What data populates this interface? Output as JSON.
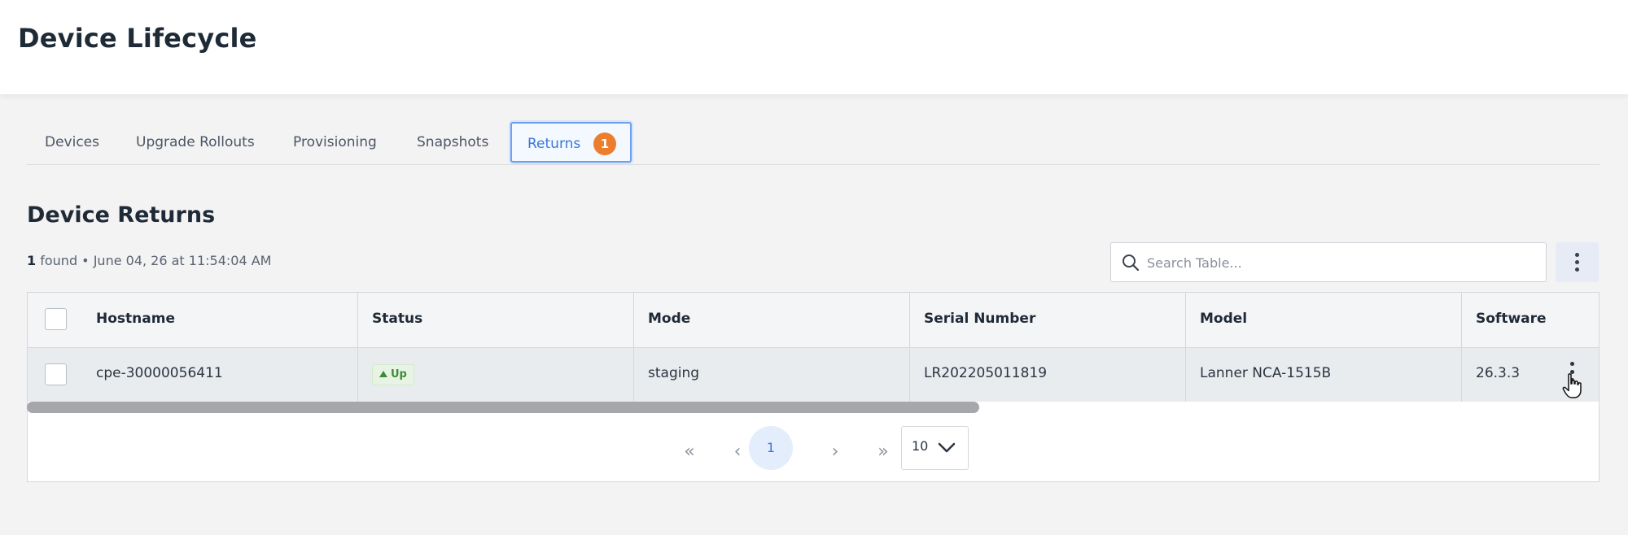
{
  "page": {
    "title": "Device Lifecycle"
  },
  "tabs": [
    {
      "label": "Devices"
    },
    {
      "label": "Upgrade Rollouts"
    },
    {
      "label": "Provisioning"
    },
    {
      "label": "Snapshots"
    },
    {
      "label": "Returns",
      "badge": "1",
      "active": true
    }
  ],
  "section": {
    "title": "Device Returns",
    "found_count": "1",
    "found_text": "found • June 04, 26 at 11:54:04 AM"
  },
  "search": {
    "placeholder": "Search Table..."
  },
  "table": {
    "columns": [
      "Hostname",
      "Status",
      "Mode",
      "Serial Number",
      "Model",
      "Software"
    ],
    "rows": [
      {
        "hostname": "cpe-30000056411",
        "status": "Up",
        "mode": "staging",
        "serial": "LR202205011819",
        "model": "Lanner NCA-1515B",
        "software": "26.3.3"
      }
    ]
  },
  "pagination": {
    "first": "«",
    "prev": "‹",
    "current_page": "1",
    "next": "›",
    "last": "»",
    "per_page": "10"
  },
  "colors": {
    "accent": "#3a78d6",
    "badge": "#ec7d2c",
    "status_up": "#3d8b37"
  },
  "icons": [
    "search-icon",
    "kebab-menu-icon",
    "chevron-down-icon",
    "hand-cursor-icon"
  ]
}
